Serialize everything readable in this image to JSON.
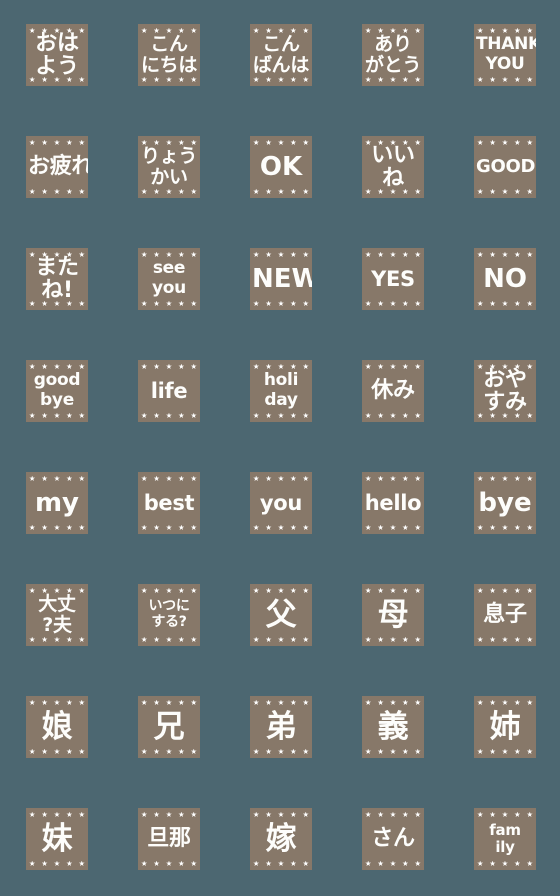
{
  "app": {
    "type": "emoji-sticker-sheet",
    "columns": 5,
    "rows": 8,
    "background_color": "#4c6771",
    "tile_color": "#877869",
    "text_color": "#fdfdfb",
    "star_color": "#ffffff",
    "stars_per_edge": 5
  },
  "tiles": [
    {
      "id": "tile-1",
      "text": "おは\nよう",
      "size": "sz-jp2",
      "lang": "ja"
    },
    {
      "id": "tile-2",
      "text": "こん\nにちは",
      "size": "sz-jp2s",
      "lang": "ja"
    },
    {
      "id": "tile-3",
      "text": "こん\nばんは",
      "size": "sz-jp2s",
      "lang": "ja"
    },
    {
      "id": "tile-4",
      "text": "あり\nがとう",
      "size": "sz-jp2s",
      "lang": "ja"
    },
    {
      "id": "tile-5",
      "text": "THANK\nYOU",
      "size": "sz-en-2l",
      "lang": "en"
    },
    {
      "id": "tile-6",
      "text": "お疲れ",
      "size": "sz-jp2",
      "lang": "ja"
    },
    {
      "id": "tile-7",
      "text": "りょう\nかい",
      "size": "sz-jp2s",
      "lang": "ja"
    },
    {
      "id": "tile-8",
      "text": "OK",
      "size": "sz-en-big",
      "lang": "en"
    },
    {
      "id": "tile-9",
      "text": "いい\nね",
      "size": "sz-jp2",
      "lang": "ja"
    },
    {
      "id": "tile-10",
      "text": "GOOD!",
      "size": "sz-en-small",
      "lang": "en"
    },
    {
      "id": "tile-11",
      "text": "また\nね!",
      "size": "sz-jp2",
      "lang": "ja"
    },
    {
      "id": "tile-12",
      "text": "see\nyou",
      "size": "sz-en-2l",
      "lang": "en"
    },
    {
      "id": "tile-13",
      "text": "NEW",
      "size": "sz-en-big",
      "lang": "en"
    },
    {
      "id": "tile-14",
      "text": "YES",
      "size": "sz-en-mid",
      "lang": "en"
    },
    {
      "id": "tile-15",
      "text": "NO",
      "size": "sz-en-big",
      "lang": "en"
    },
    {
      "id": "tile-16",
      "text": "good\nbye",
      "size": "sz-en-2l",
      "lang": "en"
    },
    {
      "id": "tile-17",
      "text": "life",
      "size": "sz-en-mid",
      "lang": "en"
    },
    {
      "id": "tile-18",
      "text": "holi\nday",
      "size": "sz-en-2l",
      "lang": "en"
    },
    {
      "id": "tile-19",
      "text": "休み",
      "size": "sz-jp2",
      "lang": "ja"
    },
    {
      "id": "tile-20",
      "text": "おや\nすみ",
      "size": "sz-jp2",
      "lang": "ja"
    },
    {
      "id": "tile-21",
      "text": "my",
      "size": "sz-en-big",
      "lang": "en"
    },
    {
      "id": "tile-22",
      "text": "best",
      "size": "sz-en-mid",
      "lang": "en"
    },
    {
      "id": "tile-23",
      "text": "you",
      "size": "sz-en-mid",
      "lang": "en"
    },
    {
      "id": "tile-24",
      "text": "hello",
      "size": "sz-en-mid",
      "lang": "en"
    },
    {
      "id": "tile-25",
      "text": "bye",
      "size": "sz-en-big",
      "lang": "en"
    },
    {
      "id": "tile-26",
      "text": "大丈\n?夫",
      "size": "sz-jp2s",
      "lang": "ja"
    },
    {
      "id": "tile-27",
      "text": "いつに\nする?",
      "size": "sz-jp4",
      "lang": "ja"
    },
    {
      "id": "tile-28",
      "text": "父",
      "size": "sz-jp1",
      "lang": "ja"
    },
    {
      "id": "tile-29",
      "text": "母",
      "size": "sz-jp1",
      "lang": "ja"
    },
    {
      "id": "tile-30",
      "text": "息子",
      "size": "sz-jp2",
      "lang": "ja"
    },
    {
      "id": "tile-31",
      "text": "娘",
      "size": "sz-jp1",
      "lang": "ja"
    },
    {
      "id": "tile-32",
      "text": "兄",
      "size": "sz-jp1",
      "lang": "ja"
    },
    {
      "id": "tile-33",
      "text": "弟",
      "size": "sz-jp1",
      "lang": "ja"
    },
    {
      "id": "tile-34",
      "text": "義",
      "size": "sz-jp1",
      "lang": "ja"
    },
    {
      "id": "tile-35",
      "text": "姉",
      "size": "sz-jp1",
      "lang": "ja"
    },
    {
      "id": "tile-36",
      "text": "妹",
      "size": "sz-jp1",
      "lang": "ja"
    },
    {
      "id": "tile-37",
      "text": "旦那",
      "size": "sz-jp2",
      "lang": "ja"
    },
    {
      "id": "tile-38",
      "text": "嫁",
      "size": "sz-jp1",
      "lang": "ja"
    },
    {
      "id": "tile-39",
      "text": "さん",
      "size": "sz-jp2",
      "lang": "ja"
    },
    {
      "id": "tile-40",
      "text": "fam\nily",
      "size": "sz-en-2ls",
      "lang": "en"
    }
  ]
}
